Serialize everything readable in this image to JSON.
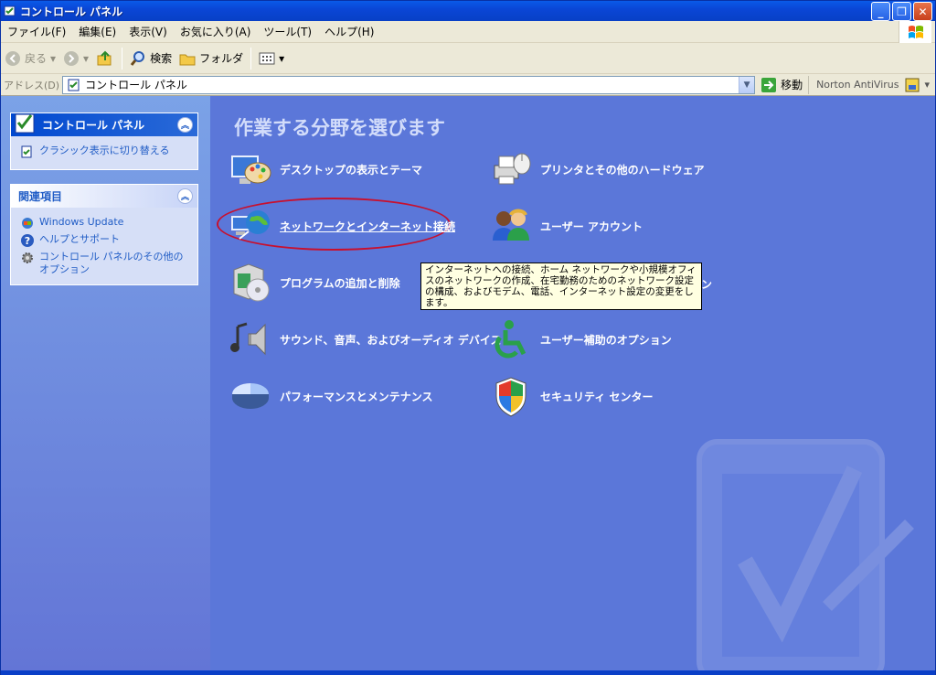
{
  "window": {
    "title": "コントロール パネル"
  },
  "menubar": {
    "items": [
      "ファイル(F)",
      "編集(E)",
      "表示(V)",
      "お気に入り(A)",
      "ツール(T)",
      "ヘルプ(H)"
    ]
  },
  "toolbar": {
    "back": "戻る",
    "search": "検索",
    "folder": "フォルダ"
  },
  "address": {
    "label": "アドレス(D)",
    "value": "コントロール パネル",
    "go": "移動",
    "norton": "Norton AntiVirus"
  },
  "sidebar": {
    "panel1": {
      "title": "コントロール パネル",
      "link": "クラシック表示に切り替える"
    },
    "panel2": {
      "title": "関連項目",
      "links": [
        "Windows Update",
        "ヘルプとサポート",
        "コントロール パネルのその他のオプション"
      ]
    }
  },
  "main": {
    "title": "作業する分野を選びます",
    "categories": [
      "デスクトップの表示とテーマ",
      "プリンタとその他のハードウェア",
      "ネットワークとインターネット接続",
      "ユーザー アカウント",
      "プログラムの追加と削除",
      "サウンド、音声、およびオーディオ デバイス",
      "ユーザー補助のオプション",
      "パフォーマンスとメンテナンス",
      "セキュリティ センター"
    ],
    "tooltip": "インターネットへの接続、ホーム ネットワークや小規模オフィスのネットワークの作成、在宅勤務のためのネットワーク設定の構成、およびモデム、電話、インターネット設定の変更をします。",
    "stray": "ン"
  }
}
